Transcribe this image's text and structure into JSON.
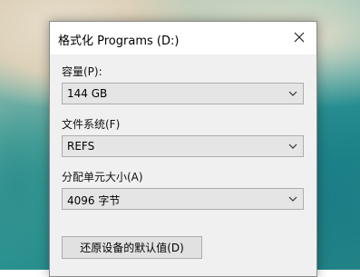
{
  "dialog": {
    "title": "格式化 Programs (D:)",
    "capacity_label": "容量(P):",
    "capacity_value": "144 GB",
    "filesystem_label": "文件系统(F)",
    "filesystem_value": "REFS",
    "allocation_label": "分配单元大小(A)",
    "allocation_value": "4096 字节",
    "restore_defaults_label": "还原设备的默认值(D)"
  },
  "icons": {
    "close": "close-icon",
    "dropdown": "chevron-down-icon"
  }
}
